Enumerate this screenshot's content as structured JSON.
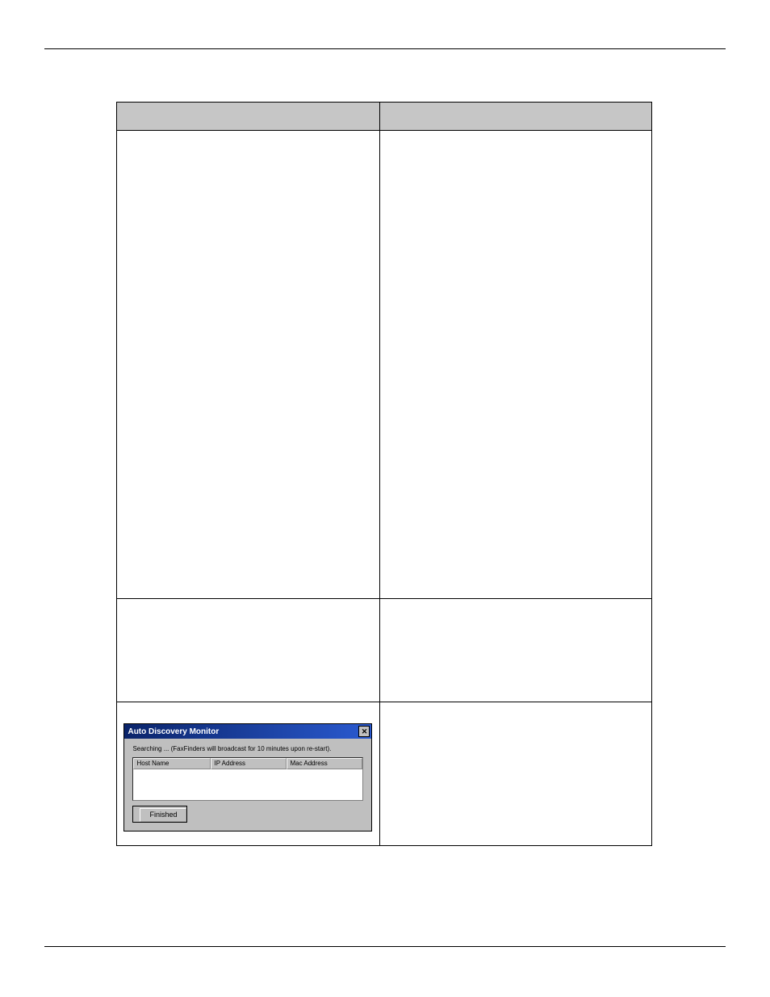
{
  "table": {
    "headers": {
      "left": "",
      "right": ""
    }
  },
  "dialog": {
    "title": "Auto Discovery Monitor",
    "message": "Searching ... (FaxFinders will broadcast for 10 minutes upon re-start).",
    "columns": {
      "host_name": "Host Name",
      "ip_address": "IP Address",
      "mac_address": "Mac Address"
    },
    "rows": [],
    "buttons": {
      "finished": "Finished"
    }
  }
}
